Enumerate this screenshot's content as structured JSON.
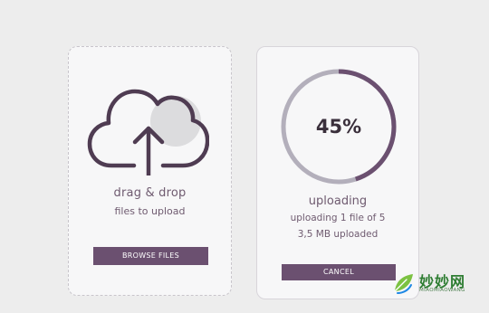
{
  "upload_card": {
    "title": "drag & drop",
    "subtitle": "files to upload",
    "browse_label": "BROWSE FILES"
  },
  "progress_card": {
    "percent_label": "45%",
    "percent_value": 45,
    "title": "uploading",
    "status_line": "uploading 1 file of 5",
    "size_line": "3,5 MB uploaded",
    "cancel_label": "CANCEL"
  },
  "watermark": {
    "name_cn": "妙妙网",
    "name_en": "MIAOMIAOWANG"
  },
  "colors": {
    "accent": "#6b5070",
    "ring_track": "#b3afbb",
    "text": "#6f5b70"
  },
  "icons": {
    "upload": "cloud-upload-icon"
  }
}
